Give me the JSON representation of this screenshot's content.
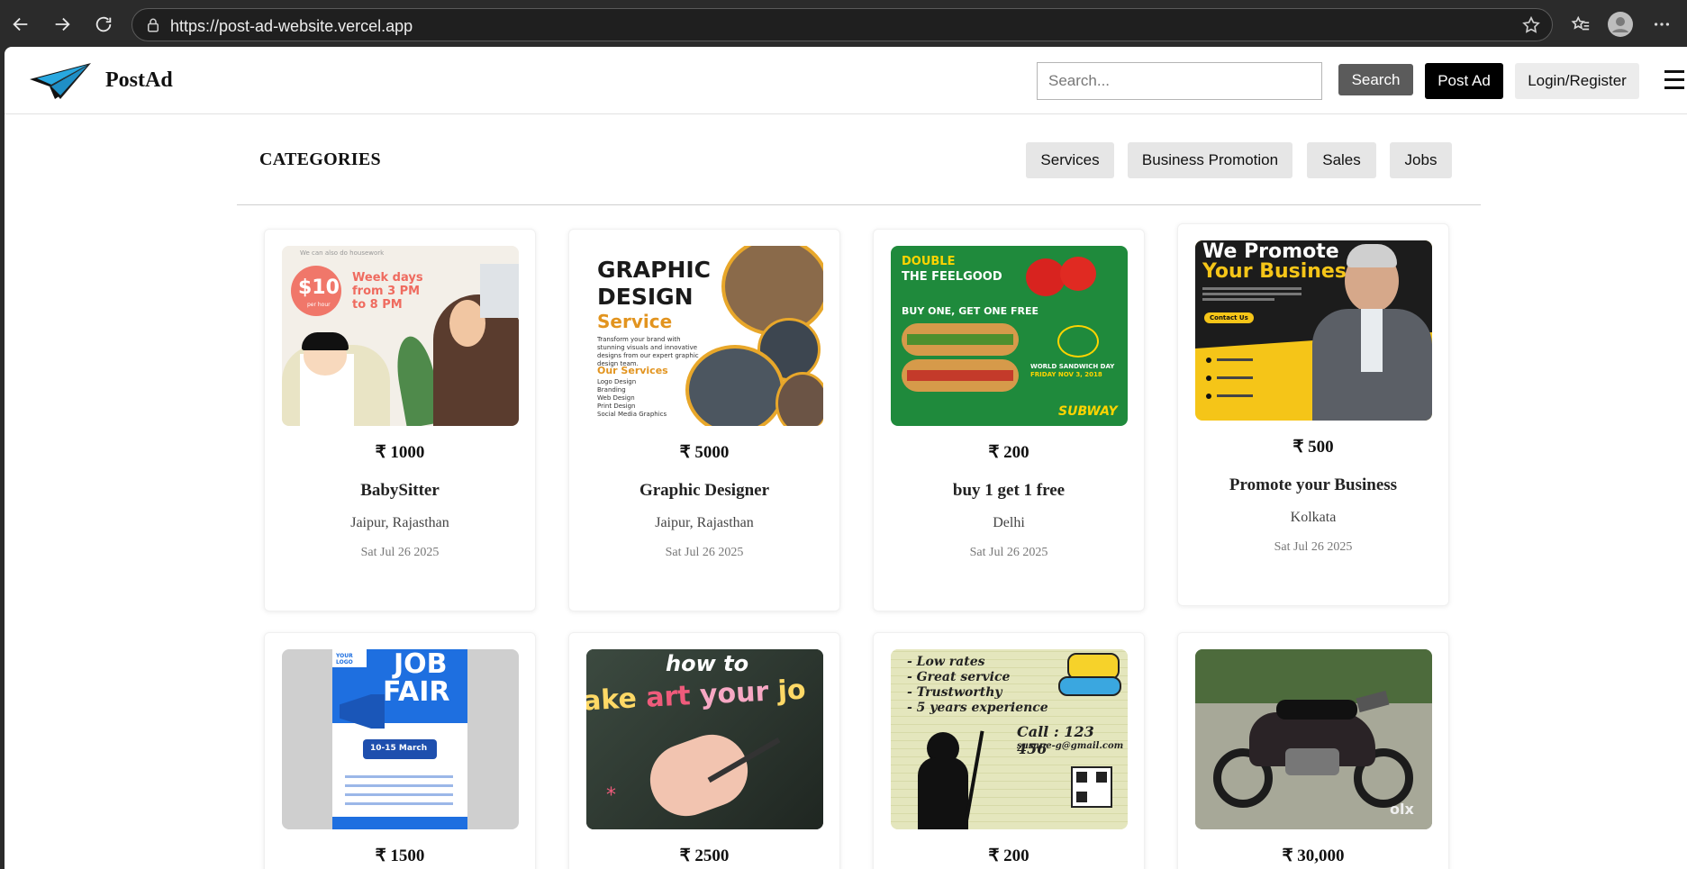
{
  "browser": {
    "url": "https://post-ad-website.vercel.app"
  },
  "header": {
    "brand": "PostAd",
    "search_placeholder": "Search...",
    "search_button": "Search",
    "post_ad_button": "Post Ad",
    "login_button": "Login/Register"
  },
  "categories": {
    "title": "CATEGORIES",
    "items": [
      "Services",
      "Business Promotion",
      "Sales",
      "Jobs"
    ]
  },
  "ads": [
    {
      "price": "₹ 1000",
      "title": "BabySitter",
      "location": "Jaipur, Rajasthan",
      "date": "Sat Jul 26 2025",
      "image": {
        "line1": "We can also do housework",
        "badge": "$10",
        "badge_sub": "per hour",
        "text": "Week days from 3 PM to 8 PM"
      }
    },
    {
      "price": "₹ 5000",
      "title": "Graphic Designer",
      "location": "Jaipur, Rajasthan",
      "date": "Sat Jul 26 2025",
      "image": {
        "heading1": "GRAPHIC",
        "heading2": "DESIGN",
        "heading3": "Service",
        "body": "Transform your brand with stunning visuals and innovative designs from our expert graphic design team.",
        "services_title": "Our Services",
        "services": [
          "Logo Design",
          "Branding",
          "Web Design",
          "Print Design",
          "Social Media Graphics"
        ]
      }
    },
    {
      "price": "₹ 200",
      "title": "buy 1 get 1 free",
      "location": "Delhi",
      "date": "Sat Jul 26 2025",
      "image": {
        "heading1": "DOUBLE",
        "heading2": "THE FEELGOOD",
        "offer": "BUY ONE, GET ONE FREE",
        "event1": "WORLD SANDWICH DAY",
        "event2": "FRIDAY NOV 3, 2018",
        "brand": "SUBWAY"
      }
    },
    {
      "price": "₹ 500",
      "title": "Promote your Business",
      "location": "Kolkata",
      "date": "Sat Jul 26 2025",
      "image": {
        "heading1": "We Promote",
        "heading2": "Your Business",
        "cta": "Contact Us"
      }
    },
    {
      "price": "₹ 1500",
      "title": "",
      "location": "",
      "date": "",
      "image": {
        "logo": "YOUR LOGO",
        "heading1": "JOB",
        "heading2": "FAIR",
        "dates": "10-15 March"
      }
    },
    {
      "price": "₹ 2500",
      "title": "",
      "location": "",
      "date": "",
      "image": {
        "line1": "how to",
        "line2a": "ake ",
        "line2b": "art ",
        "line2c": "your",
        "line2d": " jo"
      }
    },
    {
      "price": "₹ 200",
      "title": "",
      "location": "",
      "date": "",
      "image": {
        "lines": [
          "- Low rates",
          "- Great service",
          "- Trustworthy",
          "- 5 years experience"
        ],
        "call": "Call : 123 456",
        "email": "susane-g@gmail.com"
      }
    },
    {
      "price": "₹ 30,000",
      "title": "",
      "location": "",
      "date": "",
      "image": {
        "watermark": "olx"
      }
    }
  ]
}
